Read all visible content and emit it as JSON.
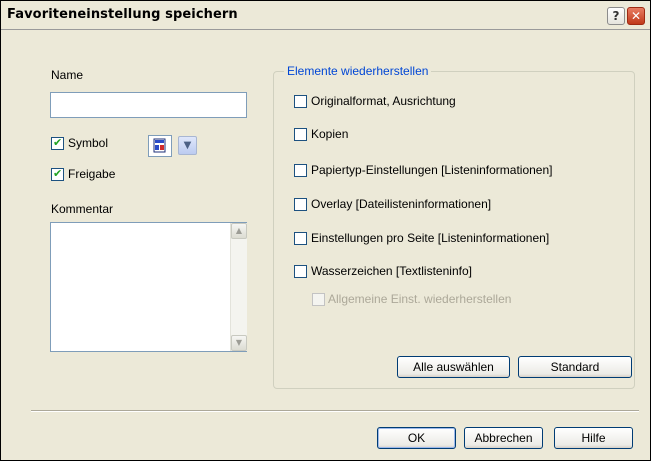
{
  "window": {
    "title": "Favoriteneinstellung speichern",
    "help_glyph": "?",
    "close_glyph": "✕"
  },
  "left": {
    "name_label": "Name",
    "name_value": "",
    "symbol_label": "Symbol",
    "symbol_checked": true,
    "freigabe_label": "Freigabe",
    "freigabe_checked": true,
    "kommentar_label": "Kommentar",
    "kommentar_value": ""
  },
  "restore_group": {
    "legend": "Elemente wiederherstellen",
    "options": [
      {
        "label": "Originalformat, Ausrichtung",
        "checked": false,
        "disabled": false
      },
      {
        "label": "Kopien",
        "checked": false,
        "disabled": false
      },
      {
        "label": "Papiertyp-Einstellungen [Listeninformationen]",
        "checked": false,
        "disabled": false
      },
      {
        "label": "Overlay [Dateilisteninformationen]",
        "checked": false,
        "disabled": false
      },
      {
        "label": "Einstellungen pro Seite [Listeninformationen]",
        "checked": false,
        "disabled": false
      },
      {
        "label": "Wasserzeichen [Textlisteninfo]",
        "checked": false,
        "disabled": false
      },
      {
        "label": "Allgemeine Einst. wiederherstellen",
        "checked": false,
        "disabled": true
      }
    ],
    "select_all_label": "Alle auswählen",
    "standard_label": "Standard"
  },
  "footer": {
    "ok_label": "OK",
    "cancel_label": "Abbrechen",
    "help_label": "Hilfe"
  },
  "icons": {
    "symbol_preview": "printer-setting-icon",
    "dropdown": "chevron-down-icon"
  }
}
